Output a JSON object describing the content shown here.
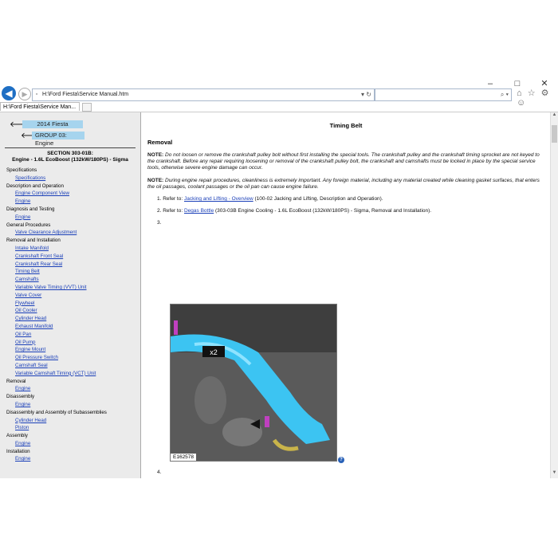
{
  "window": {
    "minimize": "–",
    "maximize": "□",
    "close": "✕"
  },
  "browser": {
    "address": "H:\\Ford Fiesta\\Service Manual.htm",
    "address_actions": "▾ ↻",
    "search_placeholder": "",
    "search_actions": "⌕ ▾",
    "tab_title": "H:\\Ford Fiesta\\Service Man...",
    "toolbar_icons": "⌂ ☆ ⚙ ☺"
  },
  "sidebar": {
    "year": "2014 Fiesta",
    "group": "GROUP 03: Engine",
    "section_line1": "SECTION 303-01B:",
    "section_line2": "Engine - 1.6L EcoBoost (132kW/180PS) - Sigma",
    "menu": [
      {
        "type": "cat",
        "label": "Specifications"
      },
      {
        "type": "item",
        "label": "Specifications"
      },
      {
        "type": "cat",
        "label": "Description and Operation"
      },
      {
        "type": "item",
        "label": "Engine Component View"
      },
      {
        "type": "item",
        "label": "Engine"
      },
      {
        "type": "cat",
        "label": "Diagnosis and Testing"
      },
      {
        "type": "item",
        "label": "Engine"
      },
      {
        "type": "cat",
        "label": "General Procedures"
      },
      {
        "type": "item",
        "label": "Valve Clearance Adjustment"
      },
      {
        "type": "cat",
        "label": "Removal and Installation"
      },
      {
        "type": "item",
        "label": "Intake Manifold"
      },
      {
        "type": "item",
        "label": "Crankshaft Front Seal"
      },
      {
        "type": "item",
        "label": "Crankshaft Rear Seal"
      },
      {
        "type": "item",
        "label": "Timing Belt"
      },
      {
        "type": "item",
        "label": "Camshafts"
      },
      {
        "type": "item",
        "label": "Variable Valve Timing (VVT) Unit"
      },
      {
        "type": "item",
        "label": "Valve Cover"
      },
      {
        "type": "item",
        "label": "Flywheel"
      },
      {
        "type": "item",
        "label": "Oil Cooler"
      },
      {
        "type": "item",
        "label": "Cylinder Head"
      },
      {
        "type": "item",
        "label": "Exhaust Manifold"
      },
      {
        "type": "item",
        "label": "Oil Pan"
      },
      {
        "type": "item",
        "label": "Oil Pump"
      },
      {
        "type": "item",
        "label": "Engine Mount"
      },
      {
        "type": "item",
        "label": "Oil Pressure Switch"
      },
      {
        "type": "item",
        "label": "Camshaft Seal"
      },
      {
        "type": "item",
        "label": "Variable Camshaft Timing (VCT) Unit"
      },
      {
        "type": "cat",
        "label": "Removal"
      },
      {
        "type": "item",
        "label": "Engine"
      },
      {
        "type": "cat",
        "label": "Disassembly"
      },
      {
        "type": "item",
        "label": "Engine"
      },
      {
        "type": "cat",
        "label": "Disassembly and Assembly of Subassemblies"
      },
      {
        "type": "item",
        "label": "Cylinder Head"
      },
      {
        "type": "item",
        "label": "Piston"
      },
      {
        "type": "cat",
        "label": "Assembly"
      },
      {
        "type": "item",
        "label": "Engine"
      },
      {
        "type": "cat",
        "label": "Installation"
      },
      {
        "type": "item",
        "label": "Engine"
      }
    ]
  },
  "main": {
    "title": "Timing Belt",
    "heading": "Removal",
    "note1_label": "NOTE:",
    "note1_text": " Do not loosen or remove the crankshaft pulley bolt without first installing the special tools. The crankshaft pulley and the crankshaft timing sprocket are not keyed to the crankshaft. Before any repair requiring loosening or removal of the crankshaft pulley bolt, the crankshaft and camshafts must be locked in place by the special service tools, otherwise severe engine damage can occur.",
    "note2_label": "NOTE:",
    "note2_text": " During engine repair procedures, cleanliness is extremely important. Any foreign material, including any material created while cleaning gasket surfaces, that enters the oil passages, coolant passages or the oil pan can cause engine failure.",
    "step1_num": "1.",
    "step1_pre": "Refer to: ",
    "step1_link": "Jacking and Lifting - Overview",
    "step1_post": " (100-02 Jacking and Lifting, Description and Operation).",
    "step2_num": "2.",
    "step2_pre": "Refer to: ",
    "step2_link": "Degas Bottle",
    "step2_post": " (303-03B Engine Cooling - 1.6L EcoBoost (132kW/180PS) - Sigma, Removal and Installation).",
    "step3_num": "3.",
    "step4_num": "4.",
    "fig1_caption": "E162578",
    "fig1_callout": "x2",
    "help": "?"
  }
}
